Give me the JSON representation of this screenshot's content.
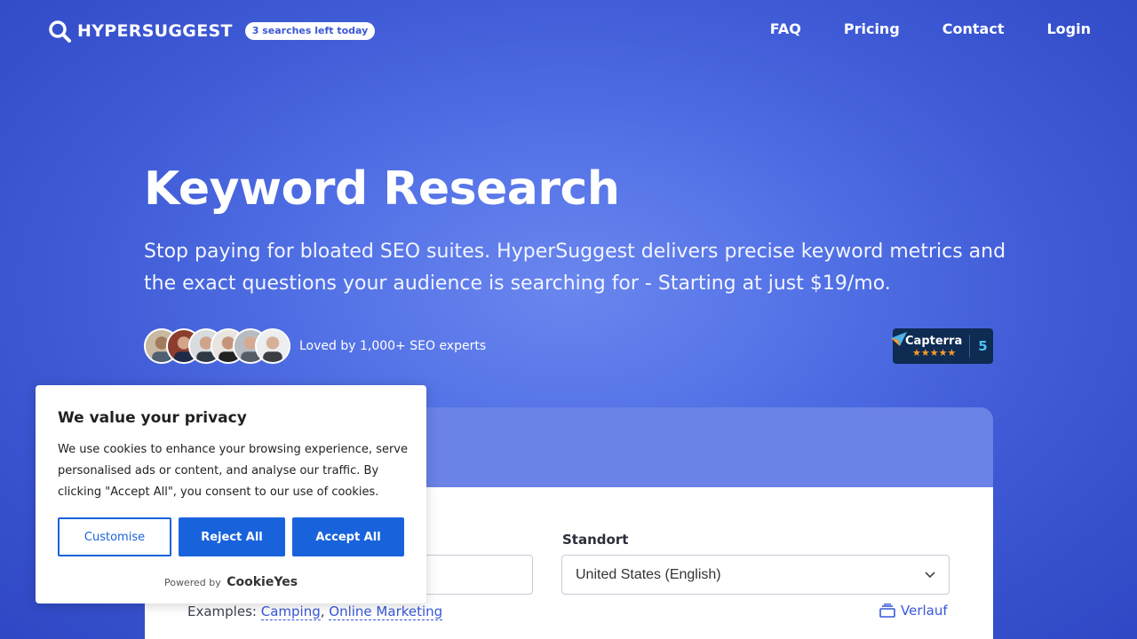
{
  "header": {
    "logo_text": "HYPERSUGGEST",
    "badge": "3 searches left today",
    "nav": [
      "FAQ",
      "Pricing",
      "Contact",
      "Login"
    ]
  },
  "hero": {
    "title": "Keyword Research",
    "subtitle": "Stop paying for bloated SEO suites. HyperSuggest delivers precise keyword metrics and the exact questions your audience is searching for - Starting at just $19/mo.",
    "social_proof": "Loved by 1,000+ SEO experts",
    "capterra": {
      "name": "Capterra",
      "stars": "★★★★★",
      "score": "5"
    }
  },
  "search": {
    "location_label": "Standort",
    "location_value": "United States (English)",
    "examples_label": "Examples:",
    "examples": [
      "Camping",
      "Online Marketing"
    ],
    "history_label": "Verlauf"
  },
  "cookie": {
    "title": "We value your privacy",
    "text": "We use cookies to enhance your browsing experience, serve personalised ads or content, and analyse our traffic. By clicking \"Accept All\", you consent to our use of cookies.",
    "customise": "Customise",
    "reject": "Reject All",
    "accept": "Accept All",
    "powered_by": "Powered by",
    "brand": "CookieYes"
  },
  "colors": {
    "accent": "#1863dc",
    "hero_bg": "#4f6ee3",
    "capterra_bg": "#0e2b52"
  }
}
